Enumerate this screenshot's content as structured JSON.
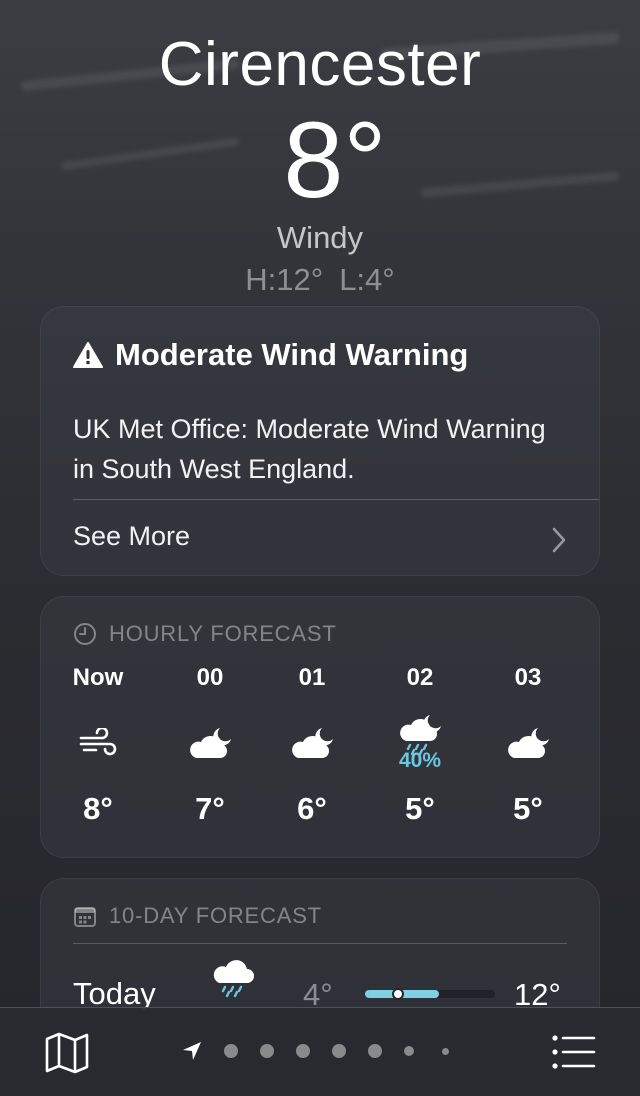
{
  "header": {
    "city": "Cirencester",
    "temperature": "8°",
    "condition": "Windy",
    "high": "H:12°",
    "low": "L:4°"
  },
  "warning": {
    "title": "Moderate Wind Warning",
    "body": "UK Met Office: Moderate Wind Warning in South West England.",
    "see_more": "See More"
  },
  "hourly": {
    "title": "HOURLY FORECAST",
    "items": [
      {
        "label": "Now",
        "icon": "wind-icon",
        "precip": "",
        "temp": "8°"
      },
      {
        "label": "00",
        "icon": "cloud-moon-icon",
        "precip": "",
        "temp": "7°"
      },
      {
        "label": "01",
        "icon": "cloud-moon-icon",
        "precip": "",
        "temp": "6°"
      },
      {
        "label": "02",
        "icon": "cloud-moon-rain-icon",
        "precip": "40%",
        "temp": "5°"
      },
      {
        "label": "03",
        "icon": "cloud-moon-icon",
        "precip": "",
        "temp": "5°"
      }
    ]
  },
  "ten_day": {
    "title": "10-DAY FORECAST",
    "days": [
      {
        "label": "Today",
        "icon": "cloud-rain-icon",
        "low": "4°",
        "high": "12°",
        "current_marker": 0.25
      }
    ]
  },
  "colors": {
    "precip": "#6cc6e0",
    "range_bar": "#7fd0e2"
  }
}
